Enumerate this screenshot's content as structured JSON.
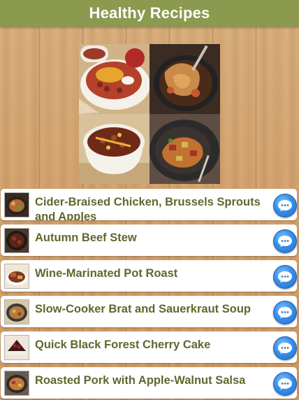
{
  "header": {
    "title": "Healthy Recipes"
  },
  "banner": {
    "tiles": [
      "chili-bowl-photo",
      "braised-dish-photo",
      "bean-soup-photo",
      "roasted-pork-photo"
    ]
  },
  "recipes": [
    {
      "title": "Cider-Braised Chicken, Brussels Sprouts and Apples",
      "thumb_icon": "braised-chicken-thumbnail",
      "action_icon": "chat-bubble-icon"
    },
    {
      "title": "Autumn Beef Stew",
      "thumb_icon": "beef-stew-thumbnail",
      "action_icon": "chat-bubble-icon"
    },
    {
      "title": "Wine-Marinated Pot Roast",
      "thumb_icon": "pot-roast-thumbnail",
      "action_icon": "chat-bubble-icon"
    },
    {
      "title": "Slow-Cooker Brat and Sauerkraut Soup",
      "thumb_icon": "soup-thumbnail",
      "action_icon": "chat-bubble-icon"
    },
    {
      "title": "Quick Black Forest Cherry Cake",
      "thumb_icon": "cherry-cake-thumbnail",
      "action_icon": "chat-bubble-icon"
    },
    {
      "title": "Roasted Pork with Apple-Walnut Salsa",
      "thumb_icon": "roasted-pork-thumbnail",
      "action_icon": "chat-bubble-icon"
    }
  ],
  "colors": {
    "header_bg": "#8b9a4f",
    "title_text": "#5a6a2d",
    "action_button": "#3a8ee8"
  }
}
